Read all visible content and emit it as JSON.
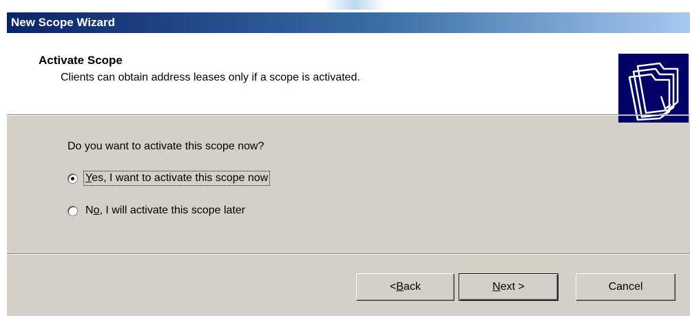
{
  "window": {
    "title": "New Scope Wizard"
  },
  "header": {
    "title": "Activate Scope",
    "subtitle": "Clients can obtain address leases only if a scope is activated.",
    "icon": "folders-icon"
  },
  "body": {
    "question": "Do you want to activate this scope now?",
    "options": [
      {
        "label_prefix": "",
        "mnemonic": "Y",
        "label_rest": "es, I want to activate this scope now",
        "checked": true
      },
      {
        "label_prefix": "N",
        "mnemonic": "o",
        "label_rest": ", I will activate this scope later",
        "checked": false
      }
    ]
  },
  "buttons": {
    "back": {
      "prefix": "< ",
      "mnemonic": "B",
      "rest": "ack"
    },
    "next": {
      "prefix": "",
      "mnemonic": "N",
      "rest": "ext >"
    },
    "cancel": "Cancel"
  },
  "colors": {
    "title_start": "#0a246a",
    "title_end": "#a6caf0",
    "dialog_bg": "#d4d0c8",
    "icon_bg": "#000066"
  }
}
